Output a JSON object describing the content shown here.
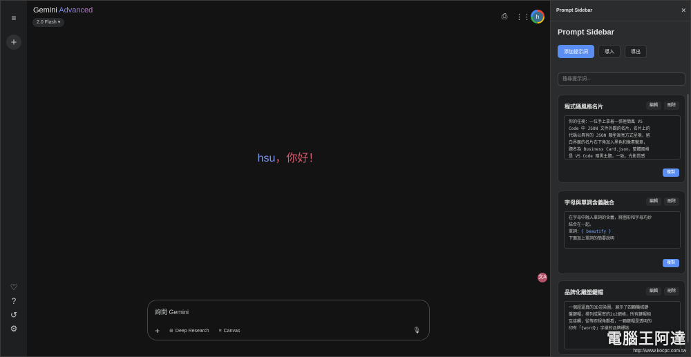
{
  "rail": {
    "menu_icon": "≡",
    "new_chat_icon": "+",
    "bottom_icons": [
      "♡",
      "?",
      "↺",
      "⚙"
    ]
  },
  "header": {
    "brand": "Gemini",
    "brand_tier": "Advanced",
    "model": "2.0 Flash ▾",
    "avatar_letter": "h"
  },
  "greeting": {
    "name": "hsu",
    "separator": "，",
    "hello": "你好！"
  },
  "floating_badge": "文A",
  "composer": {
    "placeholder": "詢問 Gemini",
    "deep_research": "Deep Research",
    "canvas": "Canvas"
  },
  "sidebar": {
    "header_label": "Prompt Sidebar",
    "title": "Prompt Sidebar",
    "add_button": "添加提示詞",
    "import_button": "導入",
    "export_button": "導出",
    "search_placeholder": "搜尋提示詞...",
    "edit_label": "編輯",
    "delete_label": "刪除",
    "copy_label": "複製",
    "cards": [
      {
        "title": "程式碼風格名片",
        "lines": [
          "你的任務：一位手上拿着一張極簡風 VS",
          "Code 中 JSON 文件外觀的名片，名片上的",
          "代碼以具有的 JSON 類型高亮方式呈現，留",
          "白界面的名片右下角加入黑色和像素徽章，",
          "題名為 Business Card.json，整體風格",
          "是 VS Code 暗黑主題，一致。光影質感"
        ]
      },
      {
        "title": "字母與單詞含義融合",
        "lines": [
          "在字母中融入單詞的含義，將圖形和字母巧妙",
          "結合在一起。",
          "單詞：",
          "下面加上單詞的簡要說明"
        ],
        "code": "{ beautify }"
      },
      {
        "title": "品牌化雕塑鍵帽",
        "lines": [
          "一個超逼真的3D渲染圖，展示了四顆機械鍵",
          "盤鍵帽，排列成緊密的2x2網格，所有鍵帽相",
          "互接觸，從等距視角觀看，一顆鍵帽是透明的",
          "印有「{word}」字樣的品牌標誌"
        ]
      }
    ]
  },
  "watermark": {
    "main": "電腦王阿達",
    "url": "http://www.kocpc.com.tw"
  }
}
